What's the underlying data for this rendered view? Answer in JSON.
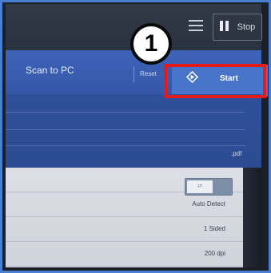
{
  "header": {
    "title": "Scan to PC",
    "reset_label": "Reset",
    "start_label": "Start"
  },
  "topbar": {
    "stop_label": "Stop",
    "menu_icon": "menu-icon"
  },
  "file_format": ".pdf",
  "settings": {
    "toggle_text": "⇄",
    "rows": [
      {
        "value": "Auto Detect"
      },
      {
        "value": "1 Sided"
      },
      {
        "value": "200 dpi"
      }
    ]
  },
  "annotation": {
    "step_number": "1",
    "highlight_color": "#e51b1b"
  }
}
